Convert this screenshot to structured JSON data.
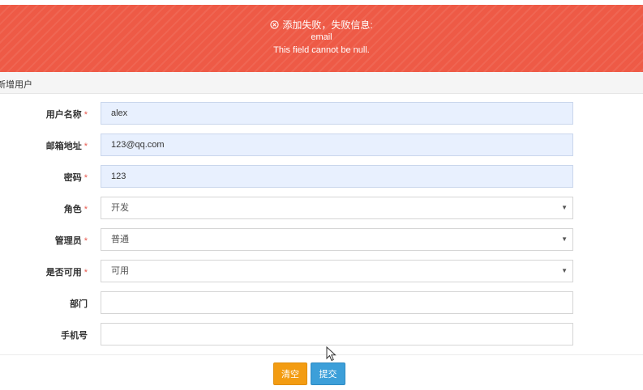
{
  "alert": {
    "message": "添加失败，失败信息:",
    "field": "email",
    "detail": "This field cannot be null.",
    "icon": "close-circle-icon"
  },
  "panel": {
    "title": "新增用户"
  },
  "form": {
    "username": {
      "label": "用户名称",
      "required": "*",
      "value": "alex"
    },
    "email": {
      "label": "邮箱地址",
      "required": "*",
      "value": "123@qq.com"
    },
    "password": {
      "label": "密码",
      "required": "*",
      "value": "123"
    },
    "role": {
      "label": "角色",
      "required": "*",
      "value": "开发"
    },
    "admin": {
      "label": "管理员",
      "required": "*",
      "value": "普通"
    },
    "enabled": {
      "label": "是否可用",
      "required": "*",
      "value": "可用"
    },
    "department": {
      "label": "部门",
      "value": ""
    },
    "phone": {
      "label": "手机号",
      "value": ""
    }
  },
  "buttons": {
    "clear": "清空",
    "submit": "提交"
  },
  "colors": {
    "alert_bg": "#ee5a46",
    "autofill_bg": "#e8f0fe",
    "required": "#e85a4f",
    "clear_btn": "#f39c12",
    "submit_btn": "#3c9fd9"
  }
}
